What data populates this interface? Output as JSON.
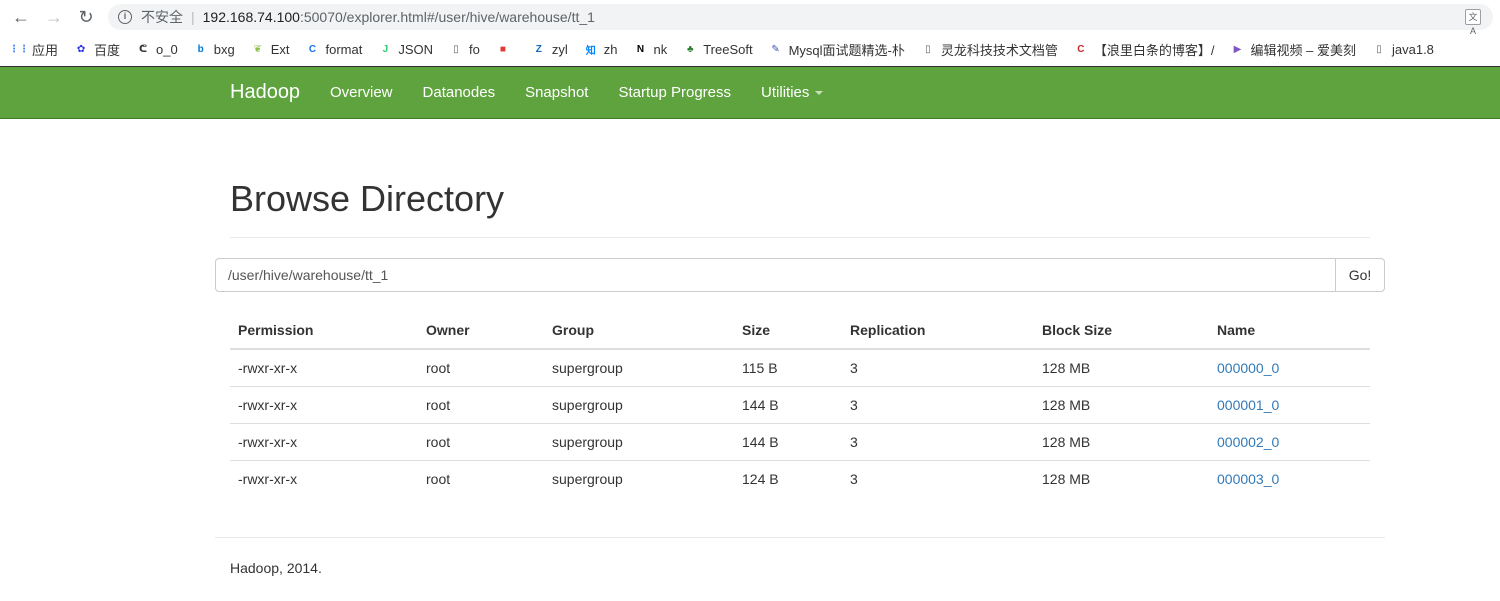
{
  "browser": {
    "back_glyph": "←",
    "forward_glyph": "→",
    "reload_glyph": "↻",
    "insecure_label": "不安全",
    "url_host": "192.168.74.100",
    "url_rest": ":50070/explorer.html#/user/hive/warehouse/tt_1"
  },
  "bookmarks": [
    {
      "label": "应用",
      "icon": "apps-grid-icon",
      "color": "#4285f4"
    },
    {
      "label": "百度",
      "icon": "baidu-paw-icon",
      "color": "#2932e1"
    },
    {
      "label": "o_0",
      "icon": "o0-icon",
      "color": "#333333"
    },
    {
      "label": "bxg",
      "icon": "bing-icon",
      "color": "#0078d7"
    },
    {
      "label": "Ext",
      "icon": "ext-leaf-icon",
      "color": "#8bc34a"
    },
    {
      "label": "format",
      "icon": "format-icon",
      "color": "#1a73e8"
    },
    {
      "label": "JSON",
      "icon": "json-icon",
      "color": "#2ecc71"
    },
    {
      "label": "fo",
      "icon": "page-icon",
      "color": "#5f6368"
    },
    {
      "label": "",
      "icon": "red-badge-icon",
      "color": "#e53935"
    },
    {
      "label": "zyl",
      "icon": "z-icon",
      "color": "#1565c0"
    },
    {
      "label": "zh",
      "icon": "zhihu-icon",
      "color": "#0084ff"
    },
    {
      "label": "nk",
      "icon": "nk-icon",
      "color": "#000000"
    },
    {
      "label": "TreeSoft",
      "icon": "tree-icon",
      "color": "#2e7d32"
    },
    {
      "label": "Mysql面试题精选-朴",
      "icon": "pencil-icon",
      "color": "#3f51b5"
    },
    {
      "label": "灵龙科技技术文档管",
      "icon": "page-icon",
      "color": "#5f6368"
    },
    {
      "label": "【浪里白条的博客】/",
      "icon": "csdn-c-icon",
      "color": "#c62828"
    },
    {
      "label": "编辑视频 – 爱美刻",
      "icon": "play-icon",
      "color": "#7e57c2"
    },
    {
      "label": "java1.8",
      "icon": "page-icon",
      "color": "#5f6368"
    }
  ],
  "navbar": {
    "brand": "Hadoop",
    "links": [
      "Overview",
      "Datanodes",
      "Snapshot",
      "Startup Progress",
      "Utilities"
    ],
    "bg_color": "#5fa33e"
  },
  "page": {
    "title": "Browse Directory",
    "path_value": "/user/hive/warehouse/tt_1",
    "go_label": "Go!"
  },
  "table": {
    "headers": [
      "Permission",
      "Owner",
      "Group",
      "Size",
      "Replication",
      "Block Size",
      "Name"
    ],
    "rows": [
      [
        "-rwxr-xr-x",
        "root",
        "supergroup",
        "115 B",
        "3",
        "128 MB",
        "000000_0"
      ],
      [
        "-rwxr-xr-x",
        "root",
        "supergroup",
        "144 B",
        "3",
        "128 MB",
        "000001_0"
      ],
      [
        "-rwxr-xr-x",
        "root",
        "supergroup",
        "144 B",
        "3",
        "128 MB",
        "000002_0"
      ],
      [
        "-rwxr-xr-x",
        "root",
        "supergroup",
        "124 B",
        "3",
        "128 MB",
        "000003_0"
      ]
    ]
  },
  "footer": "Hadoop, 2014."
}
